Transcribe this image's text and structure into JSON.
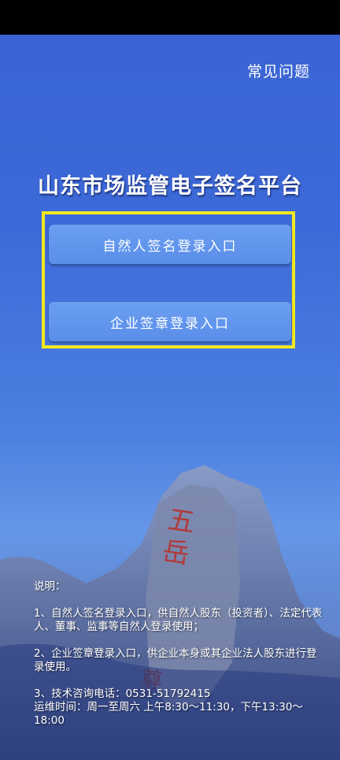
{
  "header": {
    "faq_label": "常见问题"
  },
  "title": "山东市场监管电子签名平台",
  "buttons": {
    "natural_person": "自然人签名登录入口",
    "enterprise": "企业签章登录入口"
  },
  "notes": {
    "heading": "说明：",
    "item1": "1、自然人签名登录入口，供自然人股东（投资者）、法定代表人、董事、监事等自然人登录使用；",
    "item2": "2、企业签章登录入口，供企业本身或其企业法人股东进行登录使用。",
    "item3_phone": "3、技术咨询电话：0531-51792415",
    "item3_hours": "运维时间：周一至周六 上午8:30～11:30，下午13:30～18:00"
  },
  "colors": {
    "highlight_border": "#f2e81e",
    "button_bg": "#6b9ff2",
    "background": "#3d6ad8"
  }
}
